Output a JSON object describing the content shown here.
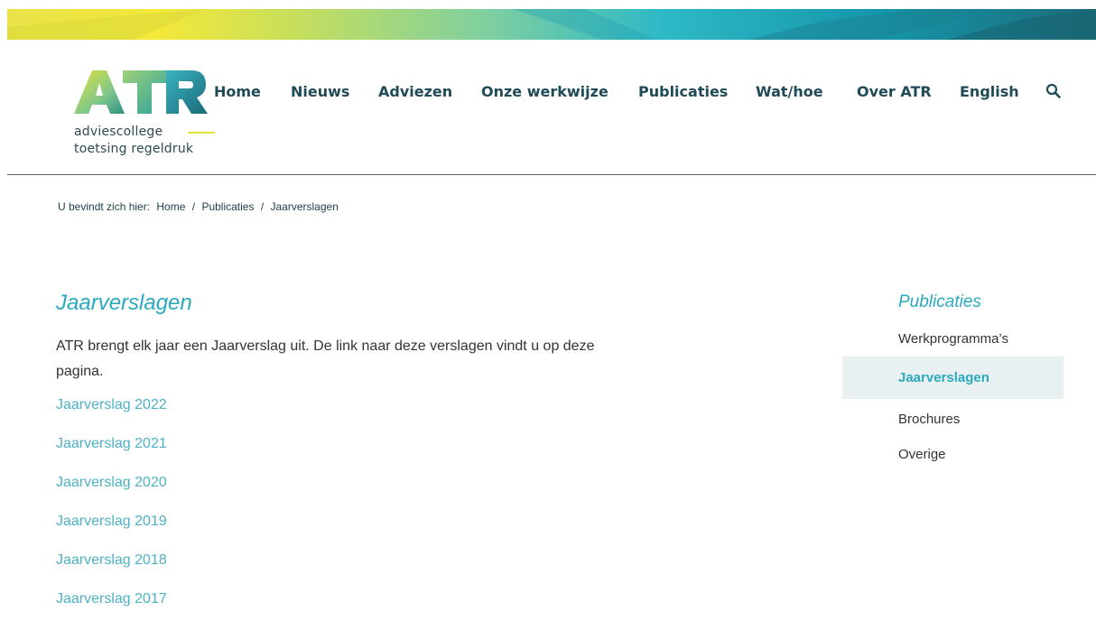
{
  "logo": {
    "letters": "ATR",
    "line1": "adviescollege",
    "line2": "toetsing regeldruk"
  },
  "nav": {
    "items": [
      {
        "label": "Home"
      },
      {
        "label": "Nieuws"
      },
      {
        "label": "Adviezen"
      },
      {
        "label": "Onze werkwijze"
      },
      {
        "label": "Publicaties"
      },
      {
        "label": "Wat/hoe"
      },
      {
        "label": "Over ATR"
      },
      {
        "label": "English"
      }
    ],
    "search_icon": "search-icon"
  },
  "breadcrumb": {
    "prefix": "U bevindt zich hier:",
    "items": [
      "Home",
      "Publicaties",
      "Jaarverslagen"
    ],
    "separator": "/"
  },
  "main": {
    "title": "Jaarverslagen",
    "intro": "ATR brengt elk jaar een Jaarverslag uit. De link naar deze verslagen vindt u op deze pagina.",
    "reports": [
      "Jaarverslag 2022",
      "Jaarverslag 2021",
      "Jaarverslag 2020",
      "Jaarverslag 2019",
      "Jaarverslag 2018",
      "Jaarverslag 2017"
    ]
  },
  "sidebar": {
    "title": "Publicaties",
    "items": [
      {
        "label": "Werkprogramma’s",
        "active": false
      },
      {
        "label": "Jaarverslagen",
        "active": true
      },
      {
        "label": "Brochures",
        "active": false
      },
      {
        "label": "Overige",
        "active": false
      }
    ]
  },
  "colors": {
    "accent": "#2aa9bf",
    "link": "#4db2c7",
    "nav_text": "#1f4a57",
    "active_bg": "#e8f0f1"
  }
}
